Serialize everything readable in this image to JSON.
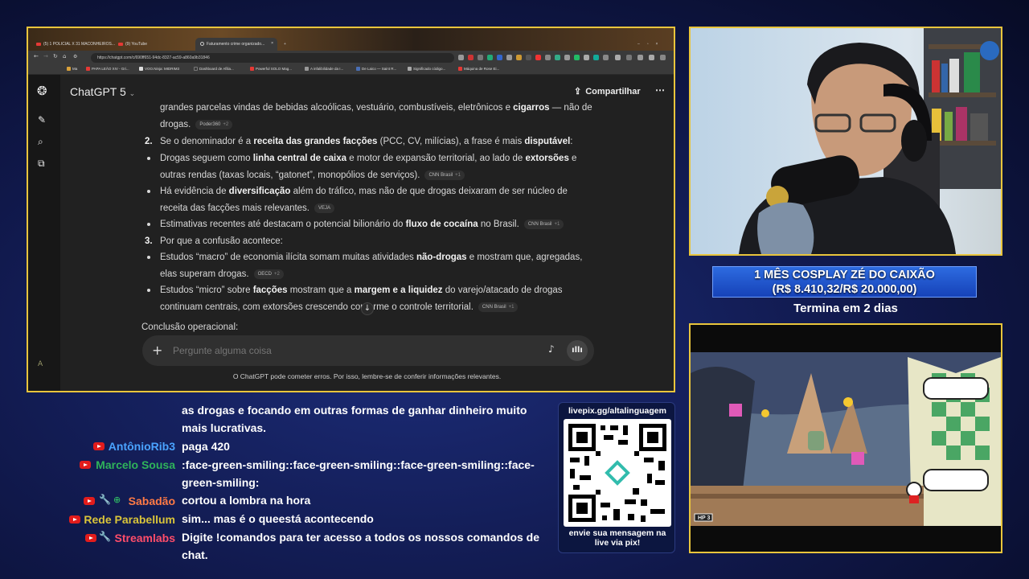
{
  "browser": {
    "tabs": [
      {
        "label": "(5) 1 POLICIAL X 31 MACONHEIROS...",
        "active": false
      },
      {
        "label": "(9) YouTube",
        "active": false
      },
      {
        "label": "Faturamento crime organizado...",
        "active": true
      }
    ],
    "url": "https://chatgpt.com/c/690ff651-94dc-8327-ac59-a860a9b31846",
    "bookmarks": [
      "Ma",
      "PAPA LEÃO XIV - Gri...",
      "VOO.Ninja: MIDRIM3",
      "Dashboard de Afilia...",
      "Powerful SOLO Mag...",
      "A infalibilidade da I...",
      "De Laico — Saint R...",
      "Significado código...",
      "Máquina de Rose Ei..."
    ]
  },
  "chatgpt": {
    "model_label": "ChatGPT 5",
    "share_label": "Compartilhar",
    "composer_placeholder": "Pergunte alguma coisa",
    "disclaimer": "O ChatGPT pode cometer erros. Por isso, lembre-se de conferir informações relevantes.",
    "content": {
      "line0": {
        "pre": "grandes parcelas vindas de bebidas alcoólicas, vestuário, combustíveis, eletrônicos e ",
        "b": "cigarros",
        "post": " — não de"
      },
      "line1": {
        "text": "drogas.",
        "src": "Poder360",
        "more": "+2"
      },
      "item2": {
        "num": "2.",
        "pre": "Se o denominador é a ",
        "b": "receita das grandes facções",
        "mid": " (PCC, CV, milícias), a frase é mais ",
        "b2": "disputável",
        "post": ":"
      },
      "b1a": {
        "pre": "Drogas seguem como ",
        "b": "linha central de caixa",
        "mid": " e motor de expansão territorial, ao lado de ",
        "b2": "extorsões",
        "post": " e"
      },
      "b1b": {
        "text": "outras rendas (taxas locais, “gatonet”, monopólios de serviços).",
        "src": "CNN Brasil",
        "more": "+1"
      },
      "b2a": {
        "pre": "Há evidência de ",
        "b": "diversificação",
        "post": " além do tráfico, mas não de que drogas deixaram de ser núcleo de"
      },
      "b2b": {
        "text": "receita das facções mais relevantes.",
        "src": "VEJA"
      },
      "b3": {
        "pre": "Estimativas recentes até destacam o potencial bilionário do ",
        "b": "fluxo de cocaína",
        "post": " no Brasil.",
        "src": "CNN Brasil",
        "more": "+1"
      },
      "item3": {
        "num": "3.",
        "text": "Por que a confusão acontece:"
      },
      "b4a": {
        "pre": "Estudos “macro” de economia ilícita somam muitas atividades ",
        "b": "não-drogas",
        "post": " e mostram que, agregadas,"
      },
      "b4b": {
        "text": "elas superam drogas.",
        "src": "OECD",
        "more": "+2"
      },
      "b5a": {
        "pre": "Estudos “micro” sobre ",
        "b": "facções",
        "mid": " mostram que a ",
        "b2": "margem e a liquidez",
        "post": " do varejo/atacado de drogas"
      },
      "b5b": {
        "text": "continuam centrais, com extorsões crescendo conforme o controle territorial.",
        "src": "CNN Brasil",
        "more": "+1"
      },
      "conclusion": "Conclusão operacional:"
    }
  },
  "goal": {
    "title": "1 MÊS COSPLAY ZÉ DO CAIXÃO",
    "progress_text": "(R$ 8.410,32/R$ 20.000,00)",
    "progress_fraction": 0.42,
    "subtitle": "Termina em 2 dias"
  },
  "chat": {
    "messages": [
      {
        "user": "",
        "user_color": "",
        "text": "as drogas e focando em outras formas de ganhar dinheiro muito mais lucrativas."
      },
      {
        "user": "AntônioRib3",
        "user_color": "#4aa3ff",
        "text": "paga 420"
      },
      {
        "user": "Marcelo Sousa",
        "user_color": "#2fb35a",
        "text": ":face-green-smiling::face-green-smiling::face-green-smiling::face-green-smiling:"
      },
      {
        "user": "Sabadão",
        "user_color": "#ff7a45",
        "text": "cortou a lombra na hora"
      },
      {
        "user": "Rede Parabellum",
        "user_color": "#d9c43a",
        "text": "sim... mas é o queestá acontecendo"
      },
      {
        "user": "Streamlabs",
        "user_color": "#ff4d6a",
        "text": "Digite !comandos para ter acesso a todos os nossos comandos de chat."
      }
    ]
  },
  "qr": {
    "url_label": "livepix.gg/altalinguagem",
    "caption": "envie sua mensagem na live via pix!"
  },
  "game": {
    "hp_label": "HP 3"
  },
  "colors": {
    "frame": "#e9c53c",
    "chatgpt_bg": "#212121",
    "goal_blue": "#2d6be0"
  }
}
